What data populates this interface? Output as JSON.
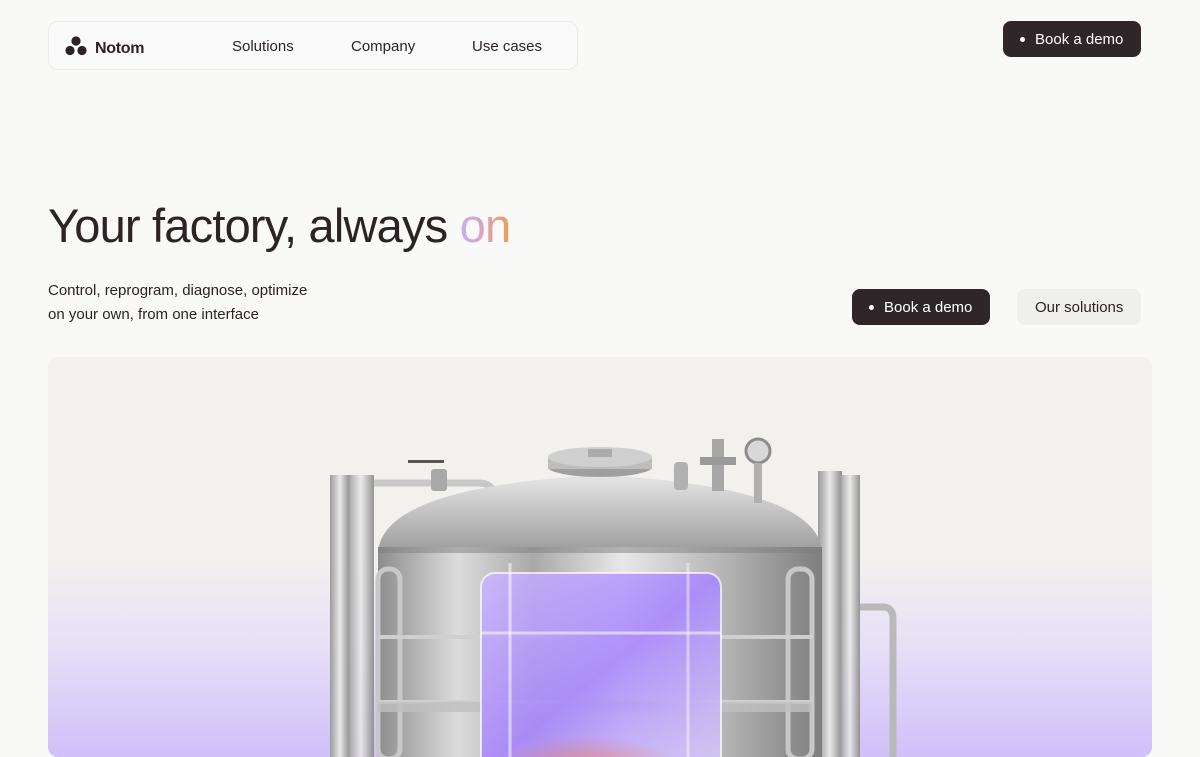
{
  "nav": {
    "brand": "Notom",
    "links": [
      "Solutions",
      "Company",
      "Use cases"
    ],
    "cta": "Book a demo"
  },
  "hero": {
    "headline_main": "Your factory, always ",
    "headline_accent": "on",
    "sub_line1": "Control, reprogram, diagnose, optimize",
    "sub_line2": "on your own, from one interface",
    "primary_cta": "Book a demo",
    "secondary_cta": "Our solutions"
  },
  "colors": {
    "background": "#f9f9f8",
    "dark_button": "#2e2629",
    "light_button": "#efefec",
    "accent_gradient_start": "#c4b1f4",
    "accent_gradient_end": "#f19b52",
    "hero_glow": "#b597fa"
  },
  "hero_image": {
    "subject": "stainless-steel-tank",
    "overlay": "purple-glass-panel"
  }
}
